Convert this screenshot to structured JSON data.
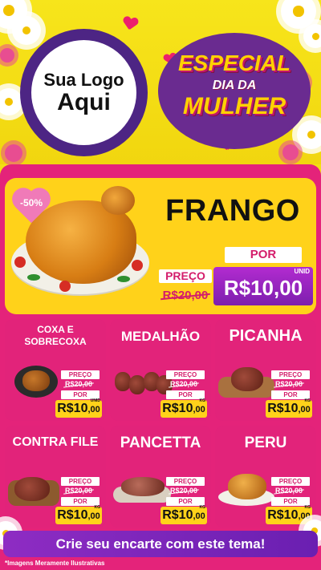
{
  "logo": {
    "line1": "Sua Logo",
    "line2": "Aqui"
  },
  "badge": {
    "line1": "ESPECIAL",
    "line2": "DIA DA",
    "line3": "MULHER"
  },
  "feature": {
    "discount": "-50%",
    "name": "FRANGO",
    "preco_label": "PREÇO",
    "old_price": "R$20,00",
    "por_label": "POR",
    "unid_label": "UNID",
    "price": "R$10,00"
  },
  "products": [
    {
      "name": "COXA E SOBRECOXA",
      "preco_label": "PREÇO",
      "old_price": "R$20,00",
      "por_label": "POR",
      "unid_label": "UNID",
      "price_main": "R$10",
      "price_cents": ",00"
    },
    {
      "name": "MEDALHÃO",
      "preco_label": "PREÇO",
      "old_price": "R$20,00",
      "por_label": "POR",
      "unid_label": "KG",
      "price_main": "R$10",
      "price_cents": ",00"
    },
    {
      "name": "PICANHA",
      "preco_label": "PREÇO",
      "old_price": "R$20,00",
      "por_label": "POR",
      "unid_label": "KG",
      "price_main": "R$10",
      "price_cents": ",00"
    },
    {
      "name": "CONTRA FILE",
      "preco_label": "PREÇO",
      "old_price": "R$20,00",
      "por_label": "POR",
      "unid_label": "KG",
      "price_main": "R$10",
      "price_cents": ",00"
    },
    {
      "name": "PANCETTA",
      "preco_label": "PREÇO",
      "old_price": "R$20,00",
      "por_label": "POR",
      "unid_label": "KG",
      "price_main": "R$10",
      "price_cents": ",00"
    },
    {
      "name": "PERU",
      "preco_label": "PREÇO",
      "old_price": "R$20,00",
      "por_label": "POR",
      "unid_label": "KG",
      "price_main": "R$10",
      "price_cents": ",00"
    }
  ],
  "cta": "Crie seu encarte com este tema!",
  "footnote": "*Imagens Meramente Ilustrativas",
  "colors": {
    "yellow": "#f3e014",
    "pink": "#e4237a",
    "purple": "#7d1fae",
    "price_yellow": "#ffd21a"
  }
}
